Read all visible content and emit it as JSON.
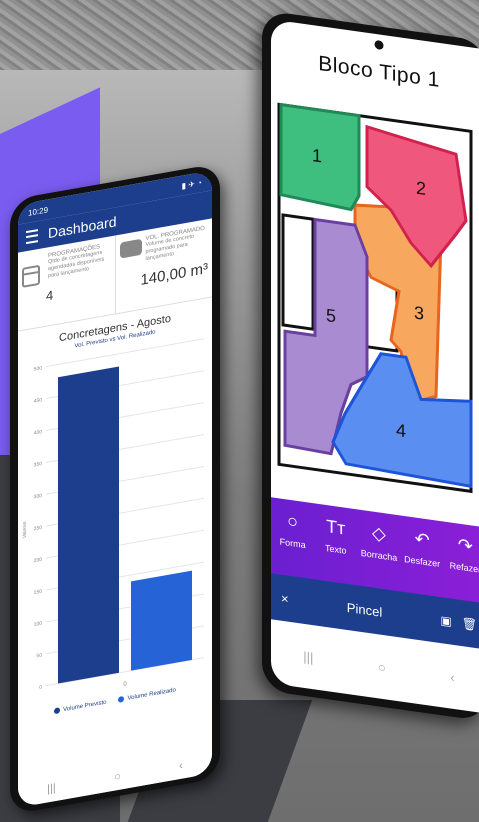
{
  "dashboard": {
    "status_time": "10:29",
    "status_icons": "▮ ✈ ◔",
    "title": "Dashboard",
    "kpi_programacoes": {
      "title": "PROGRAMAÇÕES",
      "description": "Qtde de concretagens agendadas disponíveis para lançamento",
      "value": "4"
    },
    "kpi_volume": {
      "title": "VOL. PROGRAMADO",
      "description": "Volume de concreto programado para lançamento",
      "value": "140,00 m³"
    },
    "nav": [
      "|||",
      "○",
      "‹"
    ]
  },
  "chart_data": {
    "type": "bar",
    "title": "Concretagens - Agosto",
    "subtitle": "Vol. Previsto vs Vol. Realizado",
    "ylabel": "Valores",
    "categories": [
      "0"
    ],
    "ylim": [
      0,
      500
    ],
    "yticks": [
      0,
      50,
      100,
      150,
      200,
      250,
      300,
      350,
      400,
      450,
      500
    ],
    "series": [
      {
        "name": "Volume Previsto",
        "values": [
          480
        ],
        "color": "#1d3e8c"
      },
      {
        "name": "Volume Realizado",
        "values": [
          140
        ],
        "color": "#2563d6"
      }
    ]
  },
  "editor": {
    "title": "Bloco Tipo 1",
    "regions": [
      {
        "label": "1",
        "color": "#3fbf7f"
      },
      {
        "label": "2",
        "color": "#f0577c"
      },
      {
        "label": "3",
        "color": "#f7a75e"
      },
      {
        "label": "4",
        "color": "#5a8ef0"
      },
      {
        "label": "5",
        "color": "#a98bd1"
      }
    ],
    "tools": [
      {
        "label": "Forma",
        "icon": "○"
      },
      {
        "label": "Texto",
        "icon": "Tт"
      },
      {
        "label": "Borracha",
        "icon": "◇"
      },
      {
        "label": "Desfazer",
        "icon": "↶"
      },
      {
        "label": "Refazer",
        "icon": "↷"
      }
    ],
    "mode_label": "Pincel",
    "close_icon": "×",
    "action_icons": [
      "▣",
      "🗑"
    ],
    "nav": [
      "|||",
      "○",
      "‹"
    ]
  }
}
